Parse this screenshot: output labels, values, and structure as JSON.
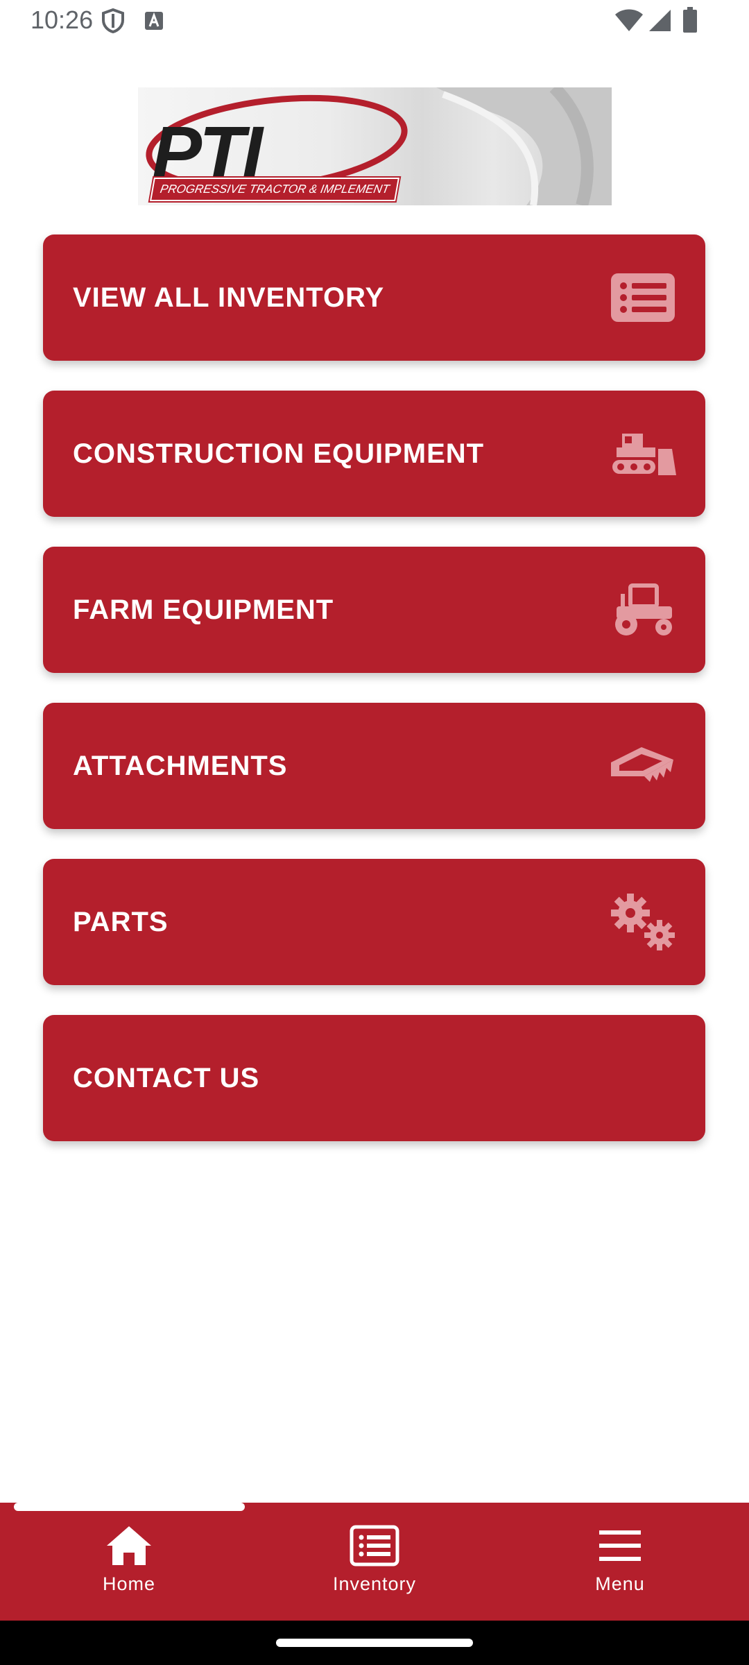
{
  "status_bar": {
    "time": "10:26",
    "left_icons": [
      "shield-icon",
      "a11y-a-icon"
    ],
    "right_icons": [
      "wifi-icon",
      "signal-icon",
      "battery-icon"
    ]
  },
  "logo": {
    "brand": "PTI",
    "tagline": "PROGRESSIVE TRACTOR & IMPLEMENT"
  },
  "menu": [
    {
      "label": "VIEW ALL INVENTORY",
      "icon": "list-icon"
    },
    {
      "label": "CONSTRUCTION EQUIPMENT",
      "icon": "bulldozer-icon"
    },
    {
      "label": "FARM EQUIPMENT",
      "icon": "tractor-icon"
    },
    {
      "label": "ATTACHMENTS",
      "icon": "bucket-attachment-icon"
    },
    {
      "label": "PARTS",
      "icon": "gears-icon"
    },
    {
      "label": "CONTACT US",
      "icon": ""
    }
  ],
  "bottom_nav": {
    "items": [
      {
        "label": "Home",
        "icon": "home-icon",
        "active": true
      },
      {
        "label": "Inventory",
        "icon": "list-icon",
        "active": false
      },
      {
        "label": "Menu",
        "icon": "hamburger-menu-icon",
        "active": false
      }
    ]
  },
  "colors": {
    "brand_red": "#b41f2c",
    "icon_faded": "#e39aa0",
    "text_on_red": "#ffffff"
  }
}
